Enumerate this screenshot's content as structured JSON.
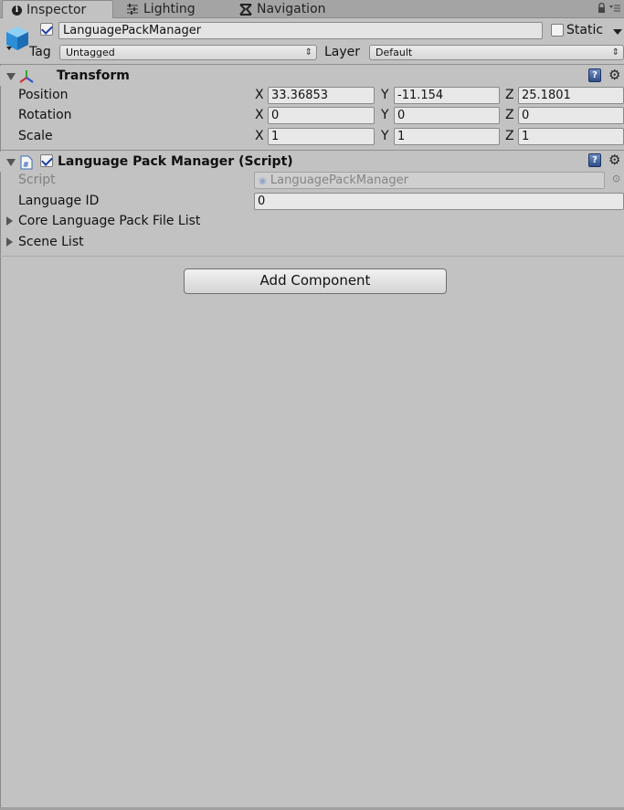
{
  "tabs": [
    {
      "label": "Inspector",
      "icon": "info-icon",
      "active": true
    },
    {
      "label": "Lighting",
      "icon": "lighting-icon",
      "active": false
    },
    {
      "label": "Navigation",
      "icon": "navigation-icon",
      "active": false
    }
  ],
  "header": {
    "object_name": "LanguagePackManager",
    "active": true,
    "static_label": "Static",
    "tag_label": "Tag",
    "tag_value": "Untagged",
    "layer_label": "Layer",
    "layer_value": "Default"
  },
  "transform": {
    "title": "Transform",
    "position": {
      "label": "Position",
      "x": "33.36853",
      "y": "-11.154",
      "z": "25.1801"
    },
    "rotation": {
      "label": "Rotation",
      "x": "0",
      "y": "0",
      "z": "0"
    },
    "scale": {
      "label": "Scale",
      "x": "1",
      "y": "1",
      "z": "1"
    }
  },
  "axis_labels": {
    "x": "X",
    "y": "Y",
    "z": "Z"
  },
  "script_component": {
    "title": "Language Pack Manager (Script)",
    "enabled": true,
    "script_label": "Script",
    "script_value": "LanguagePackManager",
    "language_id_label": "Language ID",
    "language_id_value": "0",
    "core_list_label": "Core Language Pack File List",
    "scene_list_label": "Scene List"
  },
  "add_component_label": "Add Component",
  "colors": {
    "background": "#c2c2c2",
    "tabbar": "#a4a4a4",
    "checkmark": "#1f3fa8"
  }
}
